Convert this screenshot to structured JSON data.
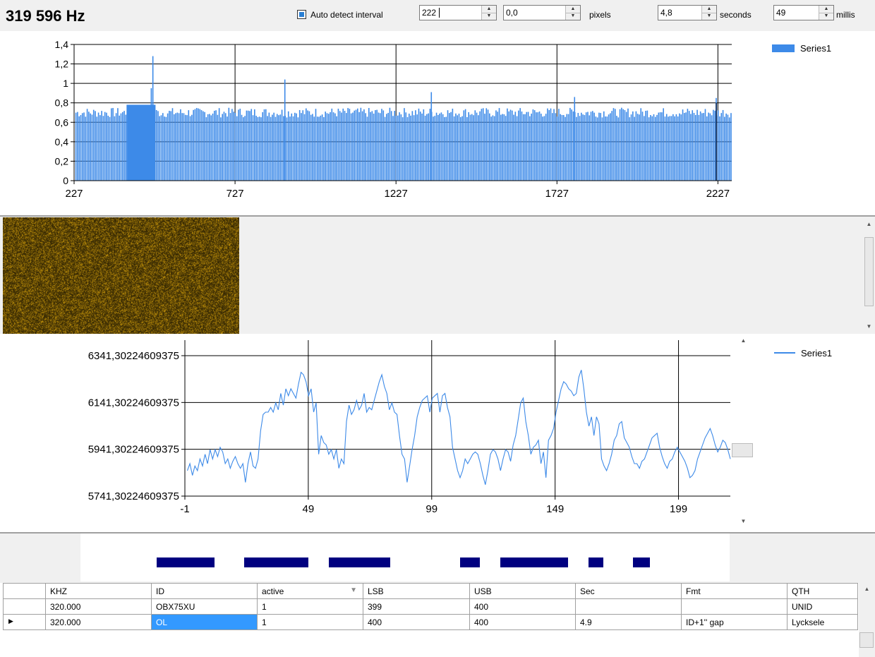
{
  "header": {
    "frequency": "319 596 Hz",
    "auto_detect_label": "Auto detect interval",
    "interval_value": "222",
    "offset_value": "0,0",
    "pixels_label": "pixels",
    "seconds_value": "4,8",
    "seconds_label": "seconds",
    "millis_value": "49",
    "millis_label": "millis"
  },
  "spectrum_chart": {
    "legend": "Series1",
    "y_ticks": [
      "1,4",
      "1,2",
      "1",
      "0,8",
      "0,6",
      "0,4",
      "0,2",
      "0"
    ],
    "x_ticks": [
      "227",
      "727",
      "1227",
      "1727",
      "2227"
    ]
  },
  "signal_chart": {
    "legend": "Series1",
    "y_ticks": [
      "6341,30224609375",
      "6141,30224609375",
      "5941,30224609375",
      "5741,30224609375"
    ],
    "x_ticks": [
      "-1",
      "49",
      "99",
      "149",
      "199"
    ]
  },
  "grid": {
    "columns": [
      "KHZ",
      "ID",
      "active",
      "LSB",
      "USB",
      "Sec",
      "Fmt",
      "QTH"
    ],
    "rows": [
      [
        "320.000",
        "OBX75XU",
        "1",
        "399",
        "400",
        "",
        "",
        "UNID"
      ],
      [
        "320.000",
        "OL",
        "1",
        "400",
        "400",
        "4.9",
        "ID+1'' gap",
        "Lycksele"
      ]
    ]
  },
  "chart_data": [
    {
      "type": "bar",
      "series": [
        {
          "name": "Series1",
          "x_range": [
            227,
            2270
          ],
          "typical_value": 0.7,
          "peaks": [
            [
              470,
              1.28
            ],
            [
              465,
              0.95
            ],
            [
              880,
              1.04
            ],
            [
              1335,
              0.91
            ],
            [
              1780,
              0.86
            ],
            [
              2220,
              0.85
            ]
          ],
          "dense_block": [
            390,
            480,
            0.78
          ]
        }
      ],
      "xlim": [
        227,
        2270
      ],
      "ylim": [
        0,
        1.4
      ]
    },
    {
      "type": "line",
      "series": [
        {
          "name": "Series1",
          "values": [
            5850,
            5880,
            5830,
            5870,
            5850,
            5900,
            5870,
            5920,
            5880,
            5940,
            5900,
            5940,
            5910,
            5950,
            5930,
            5880,
            5900,
            5860,
            5890,
            5910,
            5880,
            5860,
            5880,
            5800,
            5880,
            5930,
            5870,
            5860,
            5900,
            6020,
            6090,
            6100,
            6100,
            6120,
            6100,
            6140,
            6110,
            6180,
            6130,
            6200,
            6170,
            6200,
            6180,
            6160,
            6220,
            6270,
            6260,
            6230,
            6170,
            6200,
            6100,
            6140,
            5920,
            6000,
            5970,
            5960,
            5920,
            5940,
            5900,
            5940,
            5860,
            5900,
            5880,
            6060,
            6130,
            6090,
            6110,
            6150,
            6110,
            6130,
            6180,
            6100,
            6120,
            6110,
            6150,
            6190,
            6230,
            6260,
            6210,
            6180,
            6110,
            6140,
            6100,
            6090,
            6000,
            5920,
            5900,
            5800,
            5870,
            5940,
            6000,
            6080,
            6120,
            6150,
            6160,
            6170,
            6100,
            6160,
            6170,
            6180,
            6100,
            6170,
            6180,
            6120,
            6080,
            5950,
            5900,
            5850,
            5820,
            5850,
            5900,
            5880,
            5900,
            5920,
            5930,
            5920,
            5880,
            5830,
            5790,
            5850,
            5920,
            5940,
            5930,
            5900,
            5850,
            5900,
            5940,
            5930,
            5890,
            5960,
            6000,
            6070,
            6140,
            6160,
            6060,
            6000,
            5920,
            5950,
            5960,
            5980,
            5880,
            5930,
            5820,
            5980,
            6000,
            6030,
            6100,
            6150,
            6200,
            6230,
            6220,
            6200,
            6190,
            6170,
            6180,
            6250,
            6280,
            6200,
            6100,
            6040,
            6080,
            6000,
            6080,
            6050,
            5900,
            5870,
            5850,
            5880,
            5920,
            5980,
            6000,
            6050,
            6060,
            5990,
            5970,
            5950,
            5910,
            5880,
            5880,
            5860,
            5890,
            5900,
            5930,
            5960,
            5990,
            6000,
            6010,
            5950,
            5910,
            5880,
            5860,
            5890,
            5900,
            5930,
            5950,
            5930,
            5910,
            5890,
            5860,
            5820,
            5830,
            5850,
            5900,
            5930,
            5960,
            5990,
            6010,
            6030,
            6000,
            5960,
            5930,
            5950,
            5980,
            5970,
            5940,
            5900
          ]
        }
      ],
      "xlim": [
        -1,
        220
      ],
      "ylim": [
        5741.30224609375,
        6341.30224609375
      ]
    }
  ],
  "morse": {
    "dashes": [
      [
        222,
        304
      ],
      [
        346,
        437
      ],
      [
        466,
        553
      ],
      [
        652,
        680
      ],
      [
        709,
        805
      ],
      [
        834,
        855
      ],
      [
        897,
        921
      ]
    ]
  }
}
